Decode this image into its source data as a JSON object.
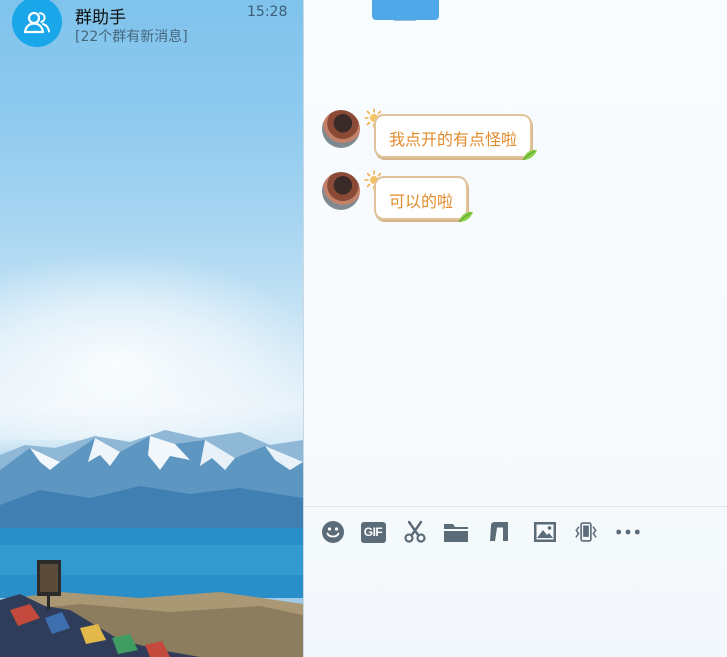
{
  "contact": {
    "name": "群助手",
    "time": "15:28",
    "preview": "[22个群有新消息]"
  },
  "messages": [
    {
      "text": "我点开的有点怪啦"
    },
    {
      "text": "可以的啦"
    }
  ],
  "toolbar": {
    "gif_label": "GIF",
    "icons": [
      "emoji-icon",
      "gif-icon",
      "scissors-icon",
      "folder-icon",
      "music-icon",
      "image-icon",
      "shake-icon",
      "more-icon"
    ]
  },
  "colors": {
    "bubble_text": "#e28b2d",
    "bubble_border": "#e0c39b",
    "group_avatar": "#1aa7ea",
    "icon_gray": "#5b6b78"
  }
}
